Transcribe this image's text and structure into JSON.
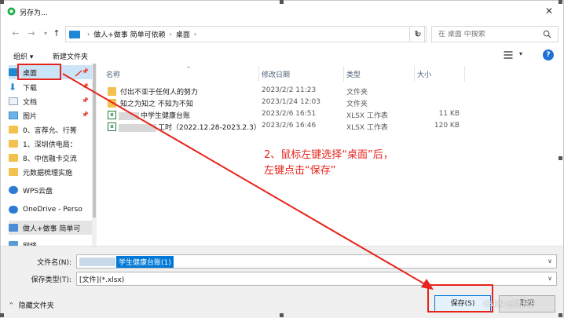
{
  "window": {
    "title": "另存为...",
    "close_glyph": "✕"
  },
  "address": {
    "breadcrumbs": [
      "做人+做事 简单可依赖",
      "桌面"
    ],
    "search_placeholder": "在 桌面 中搜索"
  },
  "toolbar": {
    "organize": "组织 ▾",
    "new_folder": "新建文件夹"
  },
  "navpane": {
    "items": [
      {
        "label": "桌面",
        "icon": "desktop-icon",
        "pinned": true,
        "selected": true
      },
      {
        "label": "下载",
        "icon": "download-icon",
        "pinned": true
      },
      {
        "label": "文档",
        "icon": "document-icon",
        "pinned": true
      },
      {
        "label": "图片",
        "icon": "picture-icon",
        "pinned": true
      },
      {
        "label": "0、言荐允、行莠",
        "icon": "folder-icon",
        "pinned": false
      },
      {
        "label": "1、深圳供电局：",
        "icon": "folder-icon",
        "pinned": false
      },
      {
        "label": "8、中信融卡交流",
        "icon": "folder-icon",
        "pinned": false
      },
      {
        "label": "元数据梳理实施",
        "icon": "folder-icon",
        "pinned": false
      },
      {
        "label": "WPS云盘",
        "icon": "cloud-icon",
        "pinned": false
      },
      {
        "label": "OneDrive - Perso",
        "icon": "cloud-icon",
        "pinned": false
      },
      {
        "label": "做人+做事 简单可",
        "icon": "computer-icon",
        "pinned": false
      },
      {
        "label": "网络",
        "icon": "network-icon",
        "pinned": false
      }
    ]
  },
  "filelist": {
    "columns": {
      "name": "名称",
      "modified": "修改日期",
      "type": "类型",
      "size": "大小"
    },
    "rows": [
      {
        "name": "付出不亚于任何人的努力",
        "modified": "2023/2/2 11:23",
        "type": "文件夹",
        "size": "",
        "kind": "folder"
      },
      {
        "name": "知之为知之  不知为不知",
        "modified": "2023/1/24 12:03",
        "type": "文件夹",
        "size": "",
        "kind": "folder"
      },
      {
        "name": "中学生健康台账",
        "modified": "2023/2/6 16:51",
        "type": "XLSX 工作表",
        "size": "11 KB",
        "kind": "xlsx"
      },
      {
        "name": "工时（2022.12.28-2023.2.3）",
        "modified": "2023/2/6 16:46",
        "type": "XLSX 工作表",
        "size": "120 KB",
        "kind": "xlsx"
      }
    ]
  },
  "bottom": {
    "filename_label": "文件名(N):",
    "filename_value": "学生健康台账(1)",
    "filetype_label": "保存类型(T):",
    "filetype_value": "[文件](*.xlsx)",
    "hide_folders": "隐藏文件夹",
    "save_button": "保存(S)",
    "cancel_button": "取消"
  },
  "annotation": {
    "line1": "2、鼠标左键选择“桌面”后，",
    "line2": "左键点击“保存”",
    "color": "#e8231c"
  },
  "watermark": "CSDN @何庆华"
}
